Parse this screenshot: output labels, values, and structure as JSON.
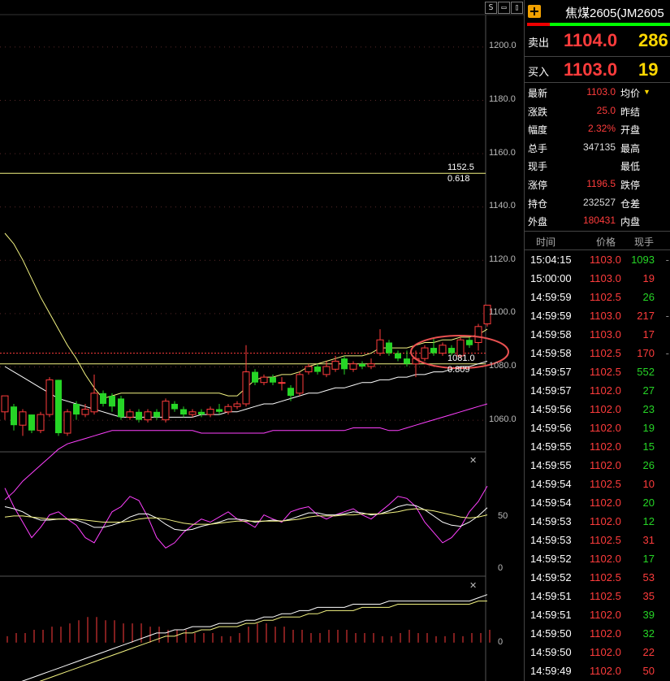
{
  "toolbar": {
    "btn_s": "S",
    "btn_min": "▭",
    "btn_max": "▯"
  },
  "colors": {
    "up": "#ff3c3c",
    "down": "#26d526",
    "ma_fast": "#f4f482",
    "ma_slow": "#ffffff",
    "lower_band": "#ff40ff",
    "fib_line": "#f4f482",
    "last_price_line": "#ff3c3c"
  },
  "chart_data": [
    {
      "type": "candlestick",
      "ylim": [
        1048,
        1212
      ],
      "y_ticks": [
        "1200.0",
        "1180.0",
        "1160.0",
        "1140.0",
        "1120.0",
        "1100.0",
        "1080.0",
        "1060.0"
      ],
      "fib_levels": [
        {
          "price": 1152.5,
          "label": "1152.5",
          "ratio": "0.618"
        },
        {
          "price": 1081.0,
          "label": "1081.0",
          "ratio": "0.809"
        }
      ],
      "last_price": 1085.0,
      "candles": [
        {
          "o": 1063.0,
          "c": 1069.0,
          "h": 1069.0,
          "l": 1060.0
        },
        {
          "o": 1065.0,
          "c": 1058.0,
          "h": 1066.0,
          "l": 1056.0
        },
        {
          "o": 1058.0,
          "c": 1063.0,
          "h": 1064.0,
          "l": 1054.0
        },
        {
          "o": 1062.0,
          "c": 1056.0,
          "h": 1062.0,
          "l": 1055.0
        },
        {
          "o": 1056.0,
          "c": 1062.0,
          "h": 1063.0,
          "l": 1055.0
        },
        {
          "o": 1062.0,
          "c": 1075.0,
          "h": 1076.0,
          "l": 1061.0
        },
        {
          "o": 1075.0,
          "c": 1055.0,
          "h": 1075.0,
          "l": 1054.0
        },
        {
          "o": 1055.0,
          "c": 1063.0,
          "h": 1064.0,
          "l": 1054.0
        },
        {
          "o": 1066.0,
          "c": 1062.0,
          "h": 1067.0,
          "l": 1060.0
        },
        {
          "o": 1062.0,
          "c": 1064.0,
          "h": 1066.0,
          "l": 1061.0
        },
        {
          "o": 1063.0,
          "c": 1070.0,
          "h": 1077.0,
          "l": 1062.0
        },
        {
          "o": 1070.0,
          "c": 1066.0,
          "h": 1071.0,
          "l": 1065.0
        },
        {
          "o": 1069.0,
          "c": 1065.0,
          "h": 1070.0,
          "l": 1063.0
        },
        {
          "o": 1068.0,
          "c": 1061.0,
          "h": 1069.0,
          "l": 1060.0
        },
        {
          "o": 1061.0,
          "c": 1063.0,
          "h": 1064.0,
          "l": 1060.0
        },
        {
          "o": 1063.0,
          "c": 1060.0,
          "h": 1064.0,
          "l": 1059.0
        },
        {
          "o": 1060.0,
          "c": 1063.0,
          "h": 1064.0,
          "l": 1059.0
        },
        {
          "o": 1063.0,
          "c": 1061.0,
          "h": 1064.0,
          "l": 1060.0
        },
        {
          "o": 1060.0,
          "c": 1067.0,
          "h": 1068.0,
          "l": 1059.0
        },
        {
          "o": 1066.0,
          "c": 1064.0,
          "h": 1067.0,
          "l": 1063.0
        },
        {
          "o": 1064.0,
          "c": 1062.0,
          "h": 1065.0,
          "l": 1061.0
        },
        {
          "o": 1062.0,
          "c": 1063.0,
          "h": 1064.0,
          "l": 1061.0
        },
        {
          "o": 1063.0,
          "c": 1062.0,
          "h": 1064.0,
          "l": 1061.0
        },
        {
          "o": 1062.0,
          "c": 1064.0,
          "h": 1065.0,
          "l": 1061.0
        },
        {
          "o": 1064.0,
          "c": 1063.0,
          "h": 1066.0,
          "l": 1062.0
        },
        {
          "o": 1063.0,
          "c": 1065.0,
          "h": 1066.0,
          "l": 1062.0
        },
        {
          "o": 1065.0,
          "c": 1066.0,
          "h": 1067.0,
          "l": 1064.0
        },
        {
          "o": 1066.0,
          "c": 1078.0,
          "h": 1088.0,
          "l": 1065.0
        },
        {
          "o": 1078.0,
          "c": 1074.0,
          "h": 1079.0,
          "l": 1073.0
        },
        {
          "o": 1074.0,
          "c": 1076.0,
          "h": 1077.0,
          "l": 1073.0
        },
        {
          "o": 1076.0,
          "c": 1074.0,
          "h": 1077.0,
          "l": 1073.0
        },
        {
          "o": 1074.0,
          "c": 1074.0,
          "h": 1076.0,
          "l": 1071.0
        },
        {
          "o": 1072.0,
          "c": 1069.0,
          "h": 1073.0,
          "l": 1067.0
        },
        {
          "o": 1070.0,
          "c": 1077.0,
          "h": 1078.0,
          "l": 1069.0
        },
        {
          "o": 1078.0,
          "c": 1080.0,
          "h": 1081.0,
          "l": 1077.0
        },
        {
          "o": 1080.0,
          "c": 1078.0,
          "h": 1081.0,
          "l": 1077.0
        },
        {
          "o": 1077.0,
          "c": 1080.0,
          "h": 1082.0,
          "l": 1076.0
        },
        {
          "o": 1079.0,
          "c": 1082.0,
          "h": 1084.0,
          "l": 1078.0
        },
        {
          "o": 1083.0,
          "c": 1079.0,
          "h": 1084.0,
          "l": 1077.0
        },
        {
          "o": 1079.0,
          "c": 1081.0,
          "h": 1082.0,
          "l": 1078.0
        },
        {
          "o": 1081.0,
          "c": 1080.0,
          "h": 1082.0,
          "l": 1079.0
        },
        {
          "o": 1080.0,
          "c": 1081.0,
          "h": 1083.0,
          "l": 1079.0
        },
        {
          "o": 1085.0,
          "c": 1090.0,
          "h": 1094.0,
          "l": 1084.0
        },
        {
          "o": 1089.0,
          "c": 1085.0,
          "h": 1090.0,
          "l": 1084.0
        },
        {
          "o": 1085.0,
          "c": 1083.0,
          "h": 1086.0,
          "l": 1082.0
        },
        {
          "o": 1083.0,
          "c": 1081.0,
          "h": 1086.0,
          "l": 1080.0
        },
        {
          "o": 1081.0,
          "c": 1083.0,
          "h": 1086.0,
          "l": 1076.0
        },
        {
          "o": 1083.0,
          "c": 1087.0,
          "h": 1088.0,
          "l": 1082.0
        },
        {
          "o": 1087.0,
          "c": 1085.0,
          "h": 1091.0,
          "l": 1084.0
        },
        {
          "o": 1085.0,
          "c": 1088.0,
          "h": 1089.0,
          "l": 1084.0
        },
        {
          "o": 1087.0,
          "c": 1085.0,
          "h": 1088.0,
          "l": 1084.0
        },
        {
          "o": 1084.0,
          "c": 1090.0,
          "h": 1091.0,
          "l": 1083.0
        },
        {
          "o": 1090.0,
          "c": 1088.0,
          "h": 1091.0,
          "l": 1087.0
        },
        {
          "o": 1089.0,
          "c": 1095.0,
          "h": 1096.0,
          "l": 1086.0
        },
        {
          "o": 1096.0,
          "c": 1103.0,
          "h": 1103.0,
          "l": 1095.0
        }
      ],
      "ma_fast": [
        1130,
        1126,
        1120,
        1113,
        1106,
        1100,
        1094,
        1088,
        1083,
        1077,
        1072,
        1068,
        1069,
        1070,
        1070,
        1070,
        1070,
        1070,
        1070,
        1070,
        1070,
        1070,
        1070,
        1070,
        1070,
        1069,
        1069,
        1072,
        1075,
        1076,
        1076,
        1077,
        1077,
        1078,
        1080,
        1081,
        1082,
        1083,
        1084,
        1084,
        1084,
        1085,
        1087,
        1087,
        1087,
        1087,
        1088,
        1089,
        1089,
        1090,
        1090,
        1091,
        1091,
        1092,
        1094
      ],
      "ma_slow": [
        1080,
        1078,
        1076,
        1074,
        1072,
        1070,
        1068,
        1067,
        1066,
        1065,
        1064,
        1063,
        1062,
        1061,
        1061,
        1061,
        1061,
        1061,
        1061,
        1061,
        1061,
        1061,
        1062,
        1062,
        1062,
        1063,
        1063,
        1064,
        1065,
        1066,
        1066,
        1067,
        1068,
        1069,
        1070,
        1070,
        1071,
        1072,
        1072,
        1073,
        1074,
        1074,
        1075,
        1075,
        1076,
        1076,
        1077,
        1077,
        1078,
        1078,
        1079,
        1080,
        1080,
        1081,
        1082
      ],
      "lower_band": [
        1030,
        1033,
        1037,
        1040,
        1043,
        1046,
        1049,
        1051,
        1052,
        1053,
        1054,
        1055,
        1056,
        1056,
        1056,
        1056,
        1056,
        1056,
        1056,
        1056,
        1056,
        1056,
        1055,
        1055,
        1055,
        1055,
        1055,
        1055,
        1055,
        1055,
        1056,
        1056,
        1056,
        1056,
        1056,
        1056,
        1056,
        1056,
        1056,
        1057,
        1057,
        1057,
        1057,
        1056,
        1056,
        1057,
        1058,
        1059,
        1060,
        1061,
        1062,
        1063,
        1064,
        1065,
        1066
      ]
    },
    {
      "type": "line",
      "ylim": [
        -5,
        110
      ],
      "y_ticks": [
        "50",
        "0"
      ],
      "close_icon": "close-icon",
      "series": [
        {
          "color": "#ff40ff",
          "values": [
            78,
            60,
            45,
            30,
            40,
            52,
            55,
            48,
            42,
            30,
            25,
            40,
            55,
            60,
            70,
            66,
            50,
            30,
            20,
            25,
            35,
            42,
            48,
            45,
            50,
            55,
            48,
            45,
            40,
            52,
            48,
            45,
            55,
            58,
            60,
            52,
            48,
            52,
            55,
            58,
            52,
            48,
            55,
            62,
            70,
            68,
            60,
            45,
            35,
            25,
            30,
            40,
            55,
            65,
            80
          ]
        },
        {
          "color": "#ffffff",
          "values": [
            60,
            58,
            55,
            50,
            47,
            47,
            48,
            48,
            47,
            44,
            40,
            40,
            42,
            45,
            50,
            53,
            53,
            49,
            43,
            38,
            37,
            38,
            41,
            43,
            45,
            48,
            48,
            47,
            45,
            46,
            47,
            46,
            48,
            51,
            54,
            54,
            52,
            52,
            53,
            55,
            54,
            52,
            53,
            56,
            60,
            62,
            61,
            57,
            51,
            45,
            42,
            41,
            45,
            51,
            59
          ]
        },
        {
          "color": "#f4f482",
          "values": [
            50,
            51,
            51,
            50,
            49,
            48,
            48,
            48,
            48,
            47,
            46,
            45,
            45,
            45,
            46,
            48,
            49,
            49,
            48,
            46,
            44,
            43,
            43,
            43,
            44,
            45,
            46,
            46,
            46,
            46,
            46,
            46,
            47,
            48,
            50,
            51,
            51,
            51,
            52,
            52,
            53,
            53,
            53,
            54,
            55,
            57,
            58,
            57,
            56,
            54,
            52,
            50,
            49,
            50,
            52
          ]
        }
      ]
    },
    {
      "type": "bar",
      "ylim": [
        -12,
        20
      ],
      "y_ticks": [
        "0"
      ],
      "close_icon": "close-icon",
      "values": [
        2,
        3,
        3,
        4,
        4,
        5,
        5,
        6,
        7,
        8,
        8,
        7,
        7,
        6,
        6,
        6,
        5,
        5,
        4,
        4,
        4,
        3,
        3,
        3,
        2,
        2,
        3,
        5,
        6,
        6,
        5,
        5,
        4,
        4,
        3,
        3,
        4,
        4,
        4,
        3,
        3,
        3,
        2,
        2,
        3,
        4,
        3,
        3,
        2,
        2,
        3,
        2,
        3,
        3,
        4
      ],
      "series": [
        {
          "color": "#ffffff",
          "values": [
            -14,
            -13,
            -12,
            -11,
            -10,
            -9,
            -8,
            -7,
            -6,
            -5,
            -4,
            -3,
            -2,
            -1,
            0,
            1,
            2,
            3,
            3,
            4,
            4,
            5,
            5,
            5,
            6,
            6,
            6,
            7,
            7,
            8,
            8,
            9,
            9,
            10,
            10,
            11,
            11,
            11,
            11,
            12,
            12,
            12,
            12,
            13,
            13,
            13,
            13,
            13,
            13,
            13,
            13,
            13,
            13,
            14,
            15
          ]
        },
        {
          "color": "#f4f482",
          "values": [
            -15,
            -15,
            -14,
            -13,
            -12,
            -11,
            -10,
            -9,
            -8,
            -7,
            -6,
            -5,
            -4,
            -3,
            -2,
            -1,
            0,
            1,
            2,
            2,
            3,
            3,
            4,
            4,
            5,
            5,
            5,
            6,
            6,
            7,
            7,
            8,
            8,
            8,
            9,
            9,
            10,
            10,
            10,
            10,
            11,
            11,
            11,
            11,
            12,
            12,
            12,
            12,
            12,
            12,
            12,
            12,
            12,
            13,
            13
          ]
        }
      ]
    }
  ],
  "panel": {
    "title": "焦煤2605(JM2605",
    "plus_icon": "+",
    "ask": {
      "label": "卖出",
      "price": "1104.0",
      "volume": "286"
    },
    "bid": {
      "label": "买入",
      "price": "1103.0",
      "volume": "19"
    },
    "stats": [
      {
        "label": "最新",
        "value": "1103.0",
        "value_color": "red",
        "label2": "均价",
        "has_arrow": true
      },
      {
        "label": "涨跌",
        "value": "25.0",
        "value_color": "red",
        "label2": "昨结"
      },
      {
        "label": "幅度",
        "value": "2.32%",
        "value_color": "red",
        "label2": "开盘"
      },
      {
        "label": "总手",
        "value": "347135",
        "value_color": "white",
        "label2": "最高"
      },
      {
        "label": "现手",
        "value": "",
        "value_color": "white",
        "label2": "最低"
      },
      {
        "label": "涨停",
        "value": "1196.5",
        "value_color": "red",
        "label2": "跌停"
      },
      {
        "label": "持仓",
        "value": "232527",
        "value_color": "white",
        "label2": "仓差"
      },
      {
        "label": "外盘",
        "value": "180431",
        "value_color": "red",
        "label2": "内盘"
      }
    ],
    "arrow_glyph": "▼",
    "trades_header": {
      "time": "时间",
      "price": "价格",
      "volume": "现手"
    },
    "trades": [
      {
        "time": "15:04:15",
        "price": "1103.0",
        "volume": "1093",
        "vcolor": "green",
        "mark": "-"
      },
      {
        "time": "15:00:00",
        "price": "1103.0",
        "volume": "19",
        "vcolor": "red",
        "mark": ""
      },
      {
        "time": "14:59:59",
        "price": "1102.5",
        "volume": "26",
        "vcolor": "green",
        "mark": ""
      },
      {
        "time": "14:59:59",
        "price": "1103.0",
        "volume": "217",
        "vcolor": "red",
        "mark": "-"
      },
      {
        "time": "14:59:58",
        "price": "1103.0",
        "volume": "17",
        "vcolor": "red",
        "mark": ""
      },
      {
        "time": "14:59:58",
        "price": "1102.5",
        "volume": "170",
        "vcolor": "red",
        "mark": "-"
      },
      {
        "time": "14:59:57",
        "price": "1102.5",
        "volume": "552",
        "vcolor": "green",
        "mark": ""
      },
      {
        "time": "14:59:57",
        "price": "1102.0",
        "volume": "27",
        "vcolor": "green",
        "mark": ""
      },
      {
        "time": "14:59:56",
        "price": "1102.0",
        "volume": "23",
        "vcolor": "green",
        "mark": ""
      },
      {
        "time": "14:59:56",
        "price": "1102.0",
        "volume": "19",
        "vcolor": "green",
        "mark": ""
      },
      {
        "time": "14:59:55",
        "price": "1102.0",
        "volume": "15",
        "vcolor": "green",
        "mark": ""
      },
      {
        "time": "14:59:55",
        "price": "1102.0",
        "volume": "26",
        "vcolor": "green",
        "mark": ""
      },
      {
        "time": "14:59:54",
        "price": "1102.5",
        "volume": "10",
        "vcolor": "red",
        "mark": ""
      },
      {
        "time": "14:59:54",
        "price": "1102.0",
        "volume": "20",
        "vcolor": "green",
        "mark": ""
      },
      {
        "time": "14:59:53",
        "price": "1102.0",
        "volume": "12",
        "vcolor": "green",
        "mark": ""
      },
      {
        "time": "14:59:53",
        "price": "1102.5",
        "volume": "31",
        "vcolor": "red",
        "mark": ""
      },
      {
        "time": "14:59:52",
        "price": "1102.0",
        "volume": "17",
        "vcolor": "green",
        "mark": ""
      },
      {
        "time": "14:59:52",
        "price": "1102.5",
        "volume": "53",
        "vcolor": "red",
        "mark": ""
      },
      {
        "time": "14:59:51",
        "price": "1102.5",
        "volume": "35",
        "vcolor": "red",
        "mark": ""
      },
      {
        "time": "14:59:51",
        "price": "1102.0",
        "volume": "39",
        "vcolor": "green",
        "mark": ""
      },
      {
        "time": "14:59:50",
        "price": "1102.0",
        "volume": "32",
        "vcolor": "green",
        "mark": ""
      },
      {
        "time": "14:59:50",
        "price": "1102.0",
        "volume": "22",
        "vcolor": "red",
        "mark": ""
      },
      {
        "time": "14:59:49",
        "price": "1102.0",
        "volume": "50",
        "vcolor": "red",
        "mark": ""
      }
    ]
  }
}
